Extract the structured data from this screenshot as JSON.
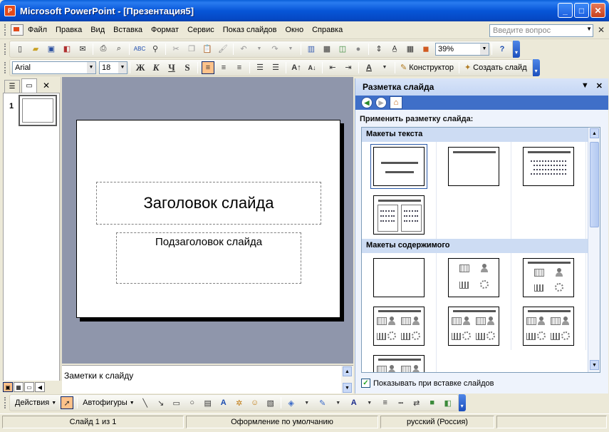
{
  "window": {
    "title": "Microsoft PowerPoint - [Презентация5]",
    "app_icon_letter": "P",
    "minimize": "_",
    "maximize": "□",
    "close": "✕"
  },
  "menu": {
    "items": [
      "Файл",
      "Правка",
      "Вид",
      "Вставка",
      "Формат",
      "Сервис",
      "Показ слайдов",
      "Окно",
      "Справка"
    ],
    "help_placeholder": "Введите вопрос",
    "close_glyph": "✕"
  },
  "standard_toolbar": {
    "zoom": "39%"
  },
  "formatting_toolbar": {
    "font": "Arial",
    "size": "18",
    "bold": "Ж",
    "italic": "К",
    "underline": "Ч",
    "shadow": "S",
    "design_button": "Конструктор",
    "new_slide_button": "Создать слайд"
  },
  "outline": {
    "slide_number": "1",
    "tab_close": "✕"
  },
  "slide": {
    "title_placeholder": "Заголовок слайда",
    "subtitle_placeholder": "Подзаголовок слайда"
  },
  "notes": {
    "placeholder": "Заметки к слайду"
  },
  "taskpane": {
    "title": "Разметка слайда",
    "apply_label": "Применить разметку слайда:",
    "group_text": "Макеты текста",
    "group_content": "Макеты содержимого",
    "show_on_insert": "Показывать при вставке слайдов",
    "show_on_insert_checked": true
  },
  "drawing_toolbar": {
    "actions": "Действия",
    "autoshapes": "Автофигуры"
  },
  "status": {
    "slide": "Слайд 1 из 1",
    "design": "Оформление по умолчанию",
    "language": "русский (Россия)"
  }
}
